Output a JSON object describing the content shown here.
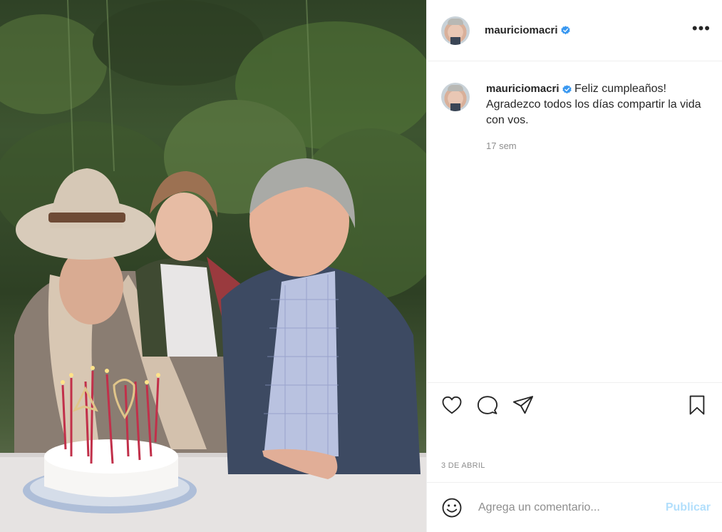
{
  "post": {
    "author": "mauriciomacri",
    "verified": true,
    "caption": "Feliz cumpleaños! Agradezco todos los días compartir la vida con vos.",
    "time_ago": "17 sem",
    "date": "3 DE ABRIL"
  },
  "icons": {
    "more": "more-options-icon",
    "like": "heart-icon",
    "comment": "comment-bubble-icon",
    "share": "paper-plane-icon",
    "save": "bookmark-icon",
    "emoji": "emoji-icon",
    "verified": "verified-badge-icon"
  },
  "comment_input": {
    "placeholder": "Agrega un comentario...",
    "submit_label": "Publicar"
  },
  "colors": {
    "verified_blue": "#3897f0",
    "publish_disabled": "#b2dffc",
    "secondary_text": "#8e8e8e"
  }
}
